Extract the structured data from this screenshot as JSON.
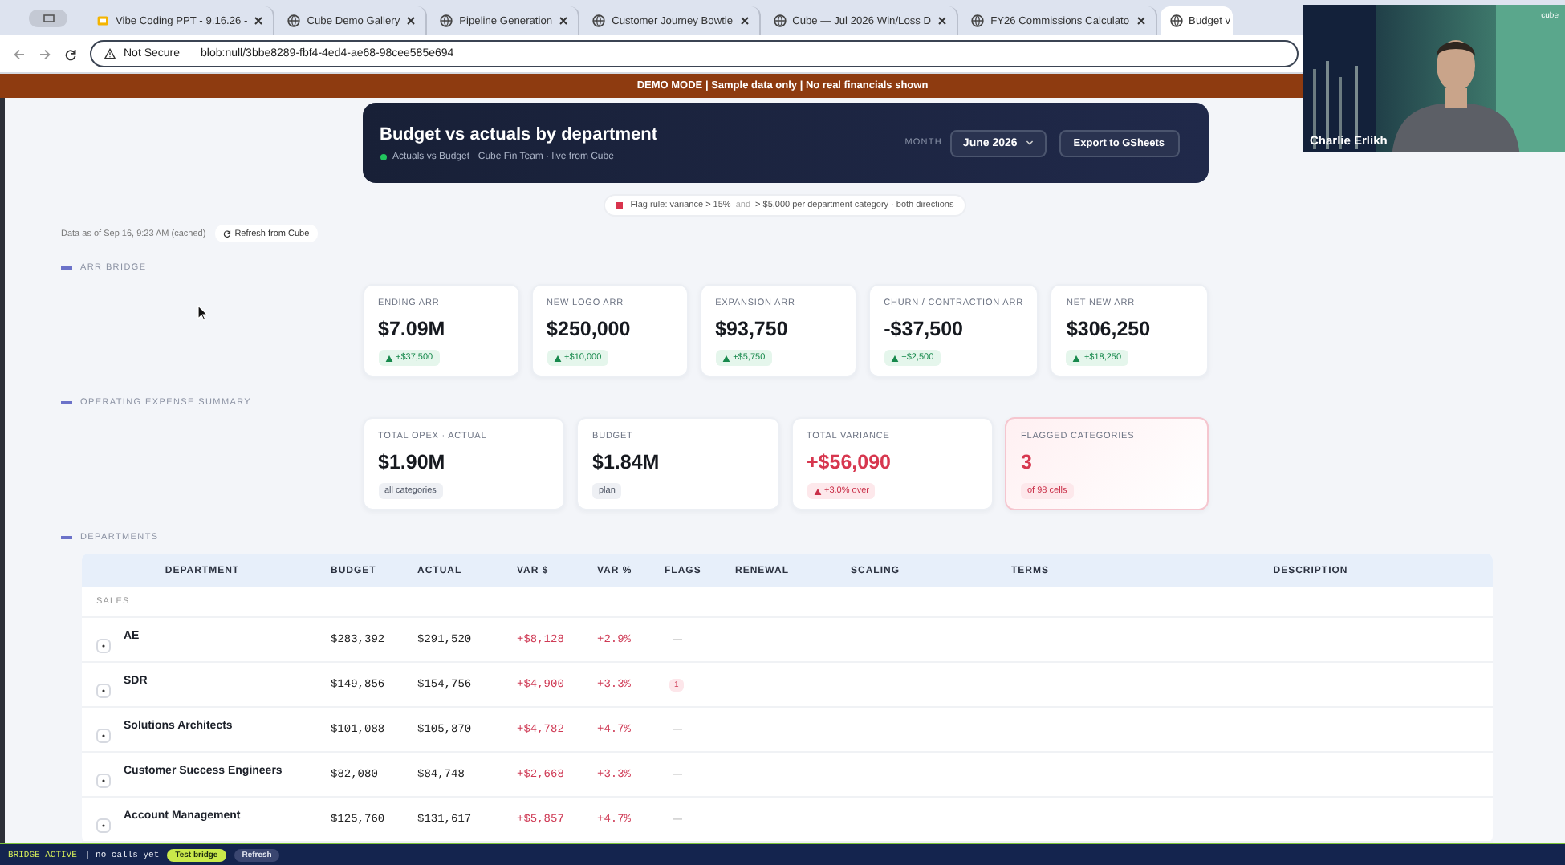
{
  "browser": {
    "tabs": [
      {
        "title": "Vibe Coding PPT - 9.16.26 -",
        "kind": "slides",
        "selected": false
      },
      {
        "title": "Cube Demo Gallery",
        "kind": "web",
        "selected": false
      },
      {
        "title": "Pipeline Generation",
        "kind": "web",
        "selected": false
      },
      {
        "title": "Customer Journey Bowtie",
        "kind": "web",
        "selected": false
      },
      {
        "title": "Cube — Jul 2026 Win/Loss D",
        "kind": "web",
        "selected": false
      },
      {
        "title": "FY26 Commissions Calculato",
        "kind": "web",
        "selected": false
      },
      {
        "title": "Budget v",
        "kind": "web",
        "selected": true
      }
    ],
    "security": "Not Secure",
    "url": "blob:null/3bbe8289-fbf4-4ed4-ae68-98cee585e694"
  },
  "banner": "DEMO MODE | Sample data only | No real financials shown",
  "header": {
    "title": "Budget vs actuals by department",
    "subtitle": "Actuals vs Budget · Cube Fin Team · live from Cube",
    "month_label": "MONTH",
    "month": "June 2026",
    "export": "Export to GSheets"
  },
  "flag_rule": {
    "before": "Flag rule: variance > 15%",
    "joiner": "and",
    "after": "> $5,000 per department category · both directions"
  },
  "data_as_of": "Data as of Sep 16, 9:23 AM (cached)",
  "refresh": "Refresh from Cube",
  "arr_bridge": {
    "label": "ARR BRIDGE",
    "cards": [
      {
        "label": "ENDING ARR",
        "value": "$7.09M",
        "badge": "+$37,500",
        "kind": "up",
        "flagged": false
      },
      {
        "label": "NEW LOGO ARR",
        "value": "$250,000",
        "badge": "+$10,000",
        "kind": "up",
        "flagged": false
      },
      {
        "label": "EXPANSION ARR",
        "value": "$93,750",
        "badge": "+$5,750",
        "kind": "up",
        "flagged": false
      },
      {
        "label": "CHURN / CONTRACTION ARR",
        "value": "-$37,500",
        "badge": "+$2,500",
        "kind": "up",
        "flagged": false
      },
      {
        "label": "NET NEW ARR",
        "value": "$306,250",
        "badge": "+$18,250",
        "kind": "up",
        "flagged": false
      }
    ]
  },
  "opex_summary": {
    "label": "OPERATING EXPENSE SUMMARY",
    "cards": [
      {
        "label": "TOTAL OPEX · ACTUAL",
        "value": "$1.90M",
        "badge": "all categories",
        "kind": "neutral",
        "flagged": false
      },
      {
        "label": "BUDGET",
        "value": "$1.84M",
        "badge": "plan",
        "kind": "neutral",
        "flagged": false
      },
      {
        "label": "TOTAL VARIANCE",
        "value": "+$56,090",
        "badge": "+3.0% over",
        "kind": "over",
        "flagged": false
      },
      {
        "label": "FLAGGED CATEGORIES",
        "value": "3",
        "badge": "of 98 cells",
        "kind": "alert",
        "flagged": true
      }
    ]
  },
  "departments": {
    "label": "DEPARTMENTS",
    "columns": [
      "DEPARTMENT",
      "BUDGET",
      "ACTUAL",
      "VAR $",
      "VAR %",
      "FLAGS",
      "RENEWAL",
      "SCALING",
      "TERMS",
      "DESCRIPTION"
    ],
    "groups": [
      {
        "name": "SALES",
        "rows": [
          {
            "name": "AE",
            "budget": "$283,392",
            "actual": "$291,520",
            "var_usd": "+$8,128",
            "var_pct": "+2.9%",
            "flags": {
              "text": "—",
              "kind": "dash"
            }
          },
          {
            "name": "SDR",
            "budget": "$149,856",
            "actual": "$154,756",
            "var_usd": "+$4,900",
            "var_pct": "+3.3%",
            "flags": {
              "text": "1",
              "kind": "badge"
            }
          },
          {
            "name": "Solutions Architects",
            "budget": "$101,088",
            "actual": "$105,870",
            "var_usd": "+$4,782",
            "var_pct": "+4.7%",
            "flags": {
              "text": "—",
              "kind": "dash"
            }
          },
          {
            "name": "Customer Success Engineers",
            "budget": "$82,080",
            "actual": "$84,748",
            "var_usd": "+$2,668",
            "var_pct": "+3.3%",
            "flags": {
              "text": "—",
              "kind": "dash"
            }
          },
          {
            "name": "Account Management",
            "budget": "$125,760",
            "actual": "$131,617",
            "var_usd": "+$5,857",
            "var_pct": "+4.7%",
            "flags": {
              "text": "—",
              "kind": "dash"
            }
          }
        ]
      }
    ]
  },
  "bridge_bar": {
    "status": "BRIDGE ACTIVE",
    "detail": "| no calls yet",
    "buttons": [
      "Test bridge",
      "Refresh"
    ]
  },
  "video_tile": {
    "participant": "Charlie Erlikh",
    "brand": "cube"
  }
}
